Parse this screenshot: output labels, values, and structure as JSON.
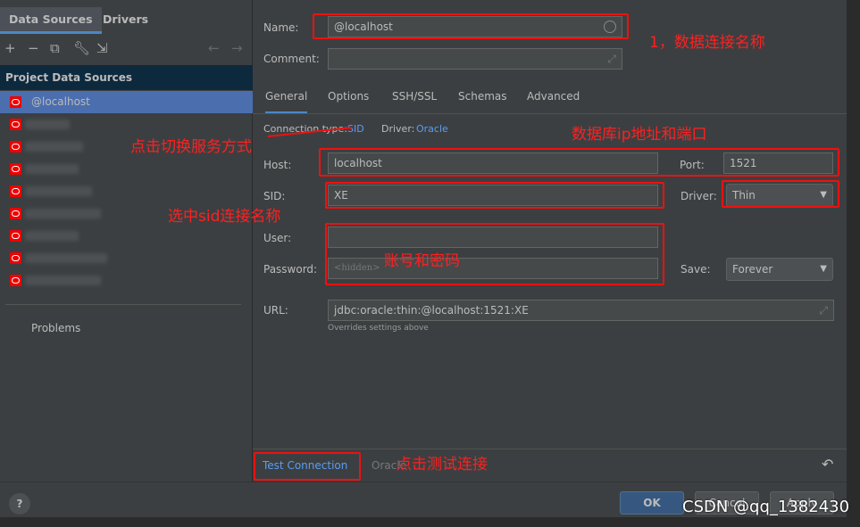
{
  "left": {
    "tabs": [
      "Data Sources",
      "Drivers"
    ],
    "section": "Project Data Sources",
    "items": [
      {
        "label": "@localhost"
      },
      {
        "label": ""
      },
      {
        "label": ""
      },
      {
        "label": ""
      },
      {
        "label": ""
      },
      {
        "label": ""
      },
      {
        "label": ""
      },
      {
        "label": ""
      },
      {
        "label": ""
      }
    ],
    "problems": "Problems"
  },
  "form": {
    "name_label": "Name:",
    "name_value": "@localhost",
    "comment_label": "Comment:",
    "tabs": [
      "General",
      "Options",
      "SSH/SSL",
      "Schemas",
      "Advanced"
    ],
    "conn_type_label": "Connection type:",
    "conn_type_value": "SID",
    "driver_label": "Driver:",
    "driver_value": "Oracle",
    "host_label": "Host:",
    "host_value": "localhost",
    "port_label": "Port:",
    "port_value": "1521",
    "sid_label": "SID:",
    "sid_value": "XE",
    "driver2_label": "Driver:",
    "driver2_value": "Thin",
    "user_label": "User:",
    "user_value": "",
    "password_label": "Password:",
    "password_placeholder": "<hidden>",
    "save_label": "Save:",
    "save_value": "Forever",
    "url_label": "URL:",
    "url_value": "jdbc:oracle:thin:@localhost:1521:XE",
    "url_hint": "Overrides settings above"
  },
  "bottom": {
    "test_connection": "Test Connection",
    "driver_name": "Oracle",
    "ok": "OK",
    "cancel": "Cancel",
    "apply": "Apply"
  },
  "annotations": {
    "name": "1，数据连接名称",
    "switch": "点击切换服务方式",
    "host": "数据库ip地址和端口",
    "sid": "选中sid连接名称",
    "account": "账号和密码",
    "test": "点击测试连接"
  },
  "watermark": "CSDN @qq_1382430",
  "colors": {
    "accent": "#4a88c7",
    "annotation": "#f01010",
    "selection": "#4b6eaf"
  }
}
